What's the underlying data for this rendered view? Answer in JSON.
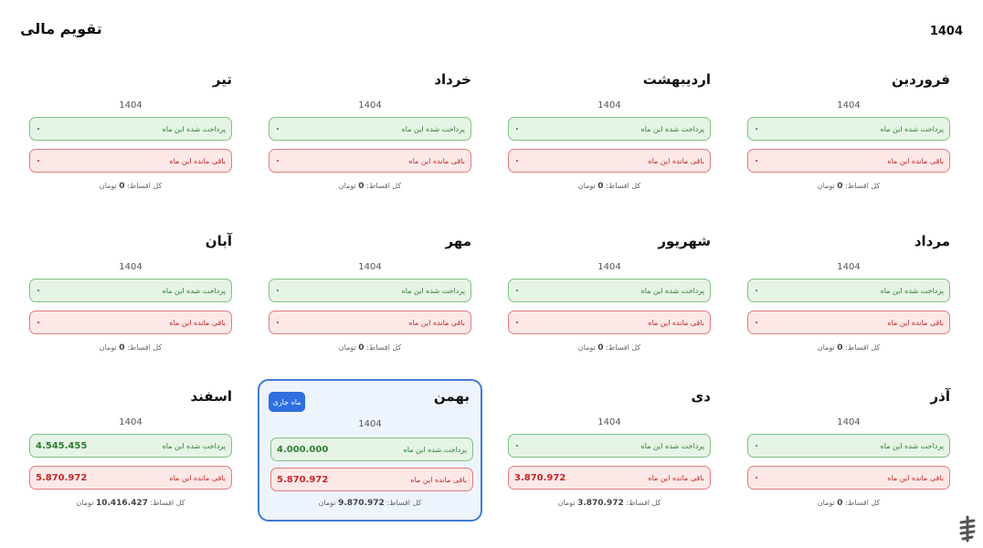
{
  "header": {
    "title": "تقویم مالی",
    "year": "1404"
  },
  "labels": {
    "paid": "پرداخت شده این ماه",
    "remaining": "باقی مانده این ماه",
    "total_prefix": "کل اقساط:",
    "currency": "تومان",
    "current_badge": "ماه جاری"
  },
  "months": [
    {
      "name": "فروردین",
      "year": "1404",
      "paid": "۰",
      "remaining": "۰",
      "total": "0",
      "current": false
    },
    {
      "name": "اردیبهشت",
      "year": "1404",
      "paid": "۰",
      "remaining": "۰",
      "total": "0",
      "current": false
    },
    {
      "name": "خرداد",
      "year": "1404",
      "paid": "۰",
      "remaining": "۰",
      "total": "0",
      "current": false
    },
    {
      "name": "تیر",
      "year": "1404",
      "paid": "۰",
      "remaining": "۰",
      "total": "0",
      "current": false
    },
    {
      "name": "مرداد",
      "year": "1404",
      "paid": "۰",
      "remaining": "۰",
      "total": "0",
      "current": false
    },
    {
      "name": "شهریور",
      "year": "1404",
      "paid": "۰",
      "remaining": "۰",
      "total": "0",
      "current": false
    },
    {
      "name": "مهر",
      "year": "1404",
      "paid": "۰",
      "remaining": "۰",
      "total": "0",
      "current": false
    },
    {
      "name": "آبان",
      "year": "1404",
      "paid": "۰",
      "remaining": "۰",
      "total": "0",
      "current": false
    },
    {
      "name": "آذر",
      "year": "1404",
      "paid": "۰",
      "remaining": "۰",
      "total": "0",
      "current": false
    },
    {
      "name": "دی",
      "year": "1404",
      "paid": "۰",
      "remaining": "3.870.972",
      "total": "3.870.972",
      "current": false
    },
    {
      "name": "بهمن",
      "year": "1404",
      "paid": "4.000.000",
      "remaining": "5.870.972",
      "total": "9.870.972",
      "current": true
    },
    {
      "name": "اسفند",
      "year": "1404",
      "paid": "4.545.455",
      "remaining": "5.870.972",
      "total": "10.416.427",
      "current": false
    }
  ],
  "colors": {
    "paid_bg": "#e6f4e6",
    "paid_border": "#7fc27f",
    "paid_text": "#2e7d32",
    "remain_bg": "#fde8e8",
    "remain_border": "#e27c7c",
    "remain_text": "#c62828",
    "current_border": "#3d7cd6",
    "current_bg": "#eef4fd",
    "badge": "#2f6fe0"
  },
  "icons": {
    "logo": "app-logo-icon"
  }
}
